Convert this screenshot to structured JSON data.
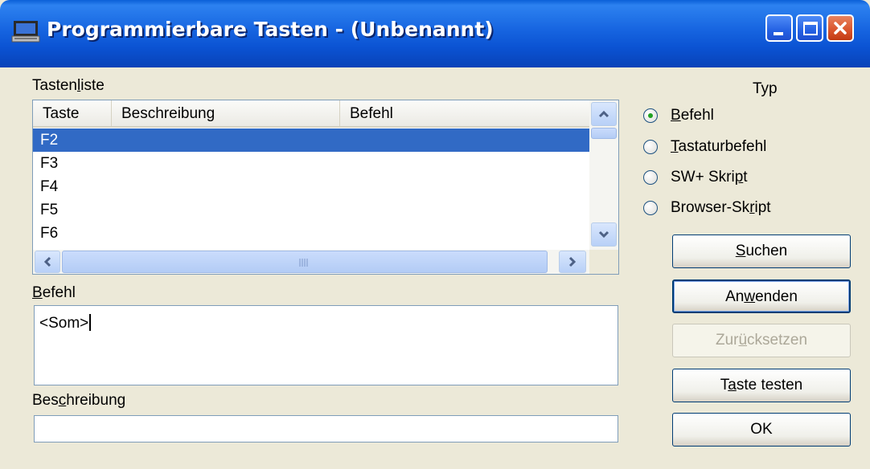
{
  "window": {
    "title": "Programmierbare Tasten - (Unbenannt)",
    "icon": "computer-icon",
    "controls": [
      "minimize-icon",
      "maximize-icon",
      "close-icon"
    ]
  },
  "keylist": {
    "label_pre": "Tasten",
    "label_mn": "l",
    "label_post": "iste",
    "columns": [
      "Taste",
      "Beschreibung",
      "Befehl"
    ],
    "rows": [
      "F2",
      "F3",
      "F4",
      "F5",
      "F6"
    ],
    "selected": "F2"
  },
  "command": {
    "label_mn": "B",
    "label_post": "efehl",
    "value": "<Som>"
  },
  "description": {
    "label_pre": "Bes",
    "label_mn": "c",
    "label_post": "hreibung",
    "value": ""
  },
  "type": {
    "label": "Typ",
    "options": [
      {
        "pre": "",
        "mn": "B",
        "post": "efehl",
        "checked": true
      },
      {
        "pre": "",
        "mn": "T",
        "post": "astaturbefehl",
        "checked": false
      },
      {
        "pre": "SW+ Skri",
        "mn": "p",
        "post": "t",
        "checked": false
      },
      {
        "pre": "Browser-Sk",
        "mn": "r",
        "post": "ipt",
        "checked": false
      }
    ]
  },
  "buttons": {
    "search": {
      "pre": "",
      "mn": "S",
      "post": "uchen"
    },
    "apply": {
      "pre": "An",
      "mn": "w",
      "post": "enden"
    },
    "reset": {
      "pre": "Zur",
      "mn": "ü",
      "post": "cksetzen",
      "disabled": true
    },
    "test": {
      "pre": "T",
      "mn": "a",
      "post": "ste testen"
    },
    "ok": {
      "label": "OK"
    }
  },
  "colors": {
    "titlebar": "#0b53d3",
    "selection": "#316ac5",
    "dialog_bg": "#ece9d8",
    "close_button": "#d9532b"
  }
}
